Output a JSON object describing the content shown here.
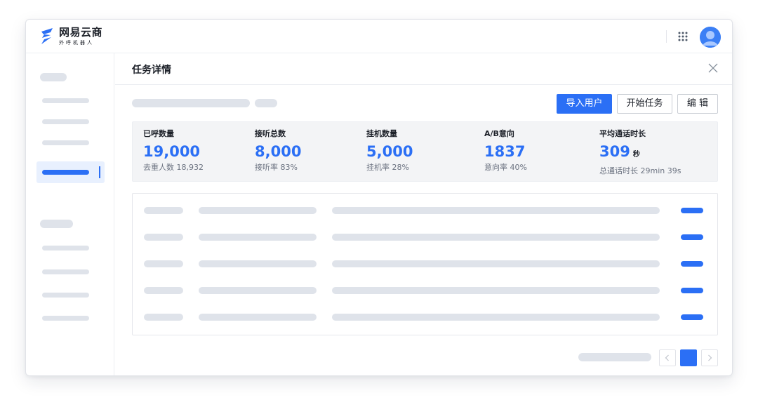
{
  "app": {
    "title": "网易云商",
    "subtitle": "外呼机器人"
  },
  "panel": {
    "title": "任务详情"
  },
  "toolbar": {
    "import_label": "导入用户",
    "start_label": "开始任务",
    "edit_label": "编 辑"
  },
  "stats": [
    {
      "label": "已呼数量",
      "value": "19,000",
      "sub": "去重人数 18,932"
    },
    {
      "label": "接听总数",
      "value": "8,000",
      "sub": "接听率 83%"
    },
    {
      "label": "挂机数量",
      "value": "5,000",
      "sub": "挂机率 28%"
    },
    {
      "label": "A/B意向",
      "value": "1837",
      "sub": "意向率 40%"
    },
    {
      "label": "平均通话时长",
      "value": "309",
      "unit": "秒",
      "sub": "总通话时长 29min 39s"
    }
  ],
  "icons": {
    "logo": "brand-logo-icon",
    "apps": "apps-grid-icon",
    "avatar": "user-avatar-icon",
    "close": "close-icon",
    "prev": "chevron-left-icon",
    "next": "chevron-right-icon"
  },
  "colors": {
    "accent": "#2b6ff5",
    "skeleton": "#dfe3ea",
    "stats_bg": "#f3f4f6",
    "active_bg": "#e8f0fe"
  }
}
